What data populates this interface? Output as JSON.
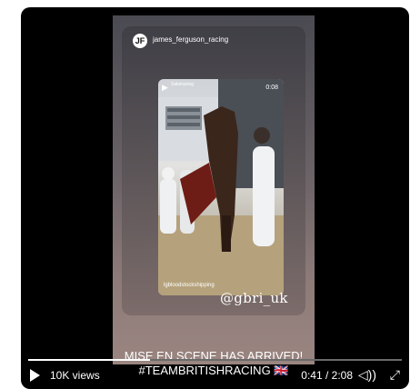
{
  "story": {
    "avatar_initials": "JF",
    "username": "james_ferguson_racing",
    "clip": {
      "tag": "Sakeracing",
      "time": "0:08",
      "credit": "lgbloodstockshipping"
    },
    "mention": "@gbri_uk",
    "caption_line1": "MISE EN SCENE HAS ARRIVED!",
    "caption_line2": "#TEAMBRITISHRACING 🇬🇧"
  },
  "player": {
    "views": "10K views",
    "time": "0:41 / 2:08",
    "progress": 0.325,
    "icons": {
      "play": "play-icon",
      "volume": "volume-icon",
      "expand": "expand-icon"
    }
  }
}
